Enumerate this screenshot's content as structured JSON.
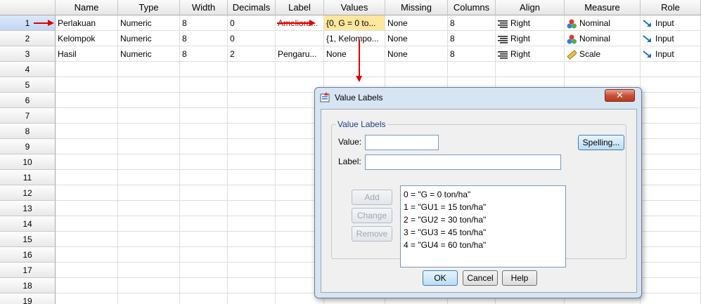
{
  "columns": [
    "Name",
    "Type",
    "Width",
    "Decimals",
    "Label",
    "Values",
    "Missing",
    "Columns",
    "Align",
    "Measure",
    "Role"
  ],
  "rows": [
    {
      "num": "1",
      "name": "Perlakuan",
      "type": "Numeric",
      "width": "8",
      "decimals": "0",
      "label": "Ameliora...",
      "values": "{0, G = 0 to...",
      "missing": "None",
      "columns": "8",
      "align": "Right",
      "measure": "Nominal",
      "role": "Input"
    },
    {
      "num": "2",
      "name": "Kelompok",
      "type": "Numeric",
      "width": "8",
      "decimals": "0",
      "label": "",
      "values": "{1, Kelompo...",
      "missing": "None",
      "columns": "8",
      "align": "Right",
      "measure": "Nominal",
      "role": "Input"
    },
    {
      "num": "3",
      "name": "Hasil",
      "type": "Numeric",
      "width": "8",
      "decimals": "2",
      "label": "Pengaru...",
      "values": "None",
      "missing": "None",
      "columns": "8",
      "align": "Right",
      "measure": "Scale",
      "role": "Input"
    }
  ],
  "empty_rows": [
    "4",
    "5",
    "6",
    "7",
    "8",
    "9",
    "10",
    "11",
    "12",
    "13",
    "14",
    "15",
    "16",
    "17",
    "18",
    "19"
  ],
  "dialog": {
    "title": "Value Labels",
    "close_label": "✕",
    "group_label": "Value Labels",
    "value_label": "Value:",
    "label_label": "Label:",
    "value_input": "",
    "label_input": "",
    "spelling_button": "Spelling...",
    "add_button": "Add",
    "change_button": "Change",
    "remove_button": "Remove",
    "items": [
      "0 = \"G = 0 ton/ha\"",
      "1 = \"GU1 = 15 ton/ha\"",
      "2 = \"GU2 = 30 ton/ha\"",
      "3 = \"GU3 = 45 ton/ha\"",
      "4 = \"GU4 = 60 ton/ha\""
    ],
    "ok_button": "OK",
    "cancel_button": "Cancel",
    "help_button": "Help"
  },
  "colors": {
    "accent": "#e00000",
    "highlight": "#ffe7a0"
  }
}
